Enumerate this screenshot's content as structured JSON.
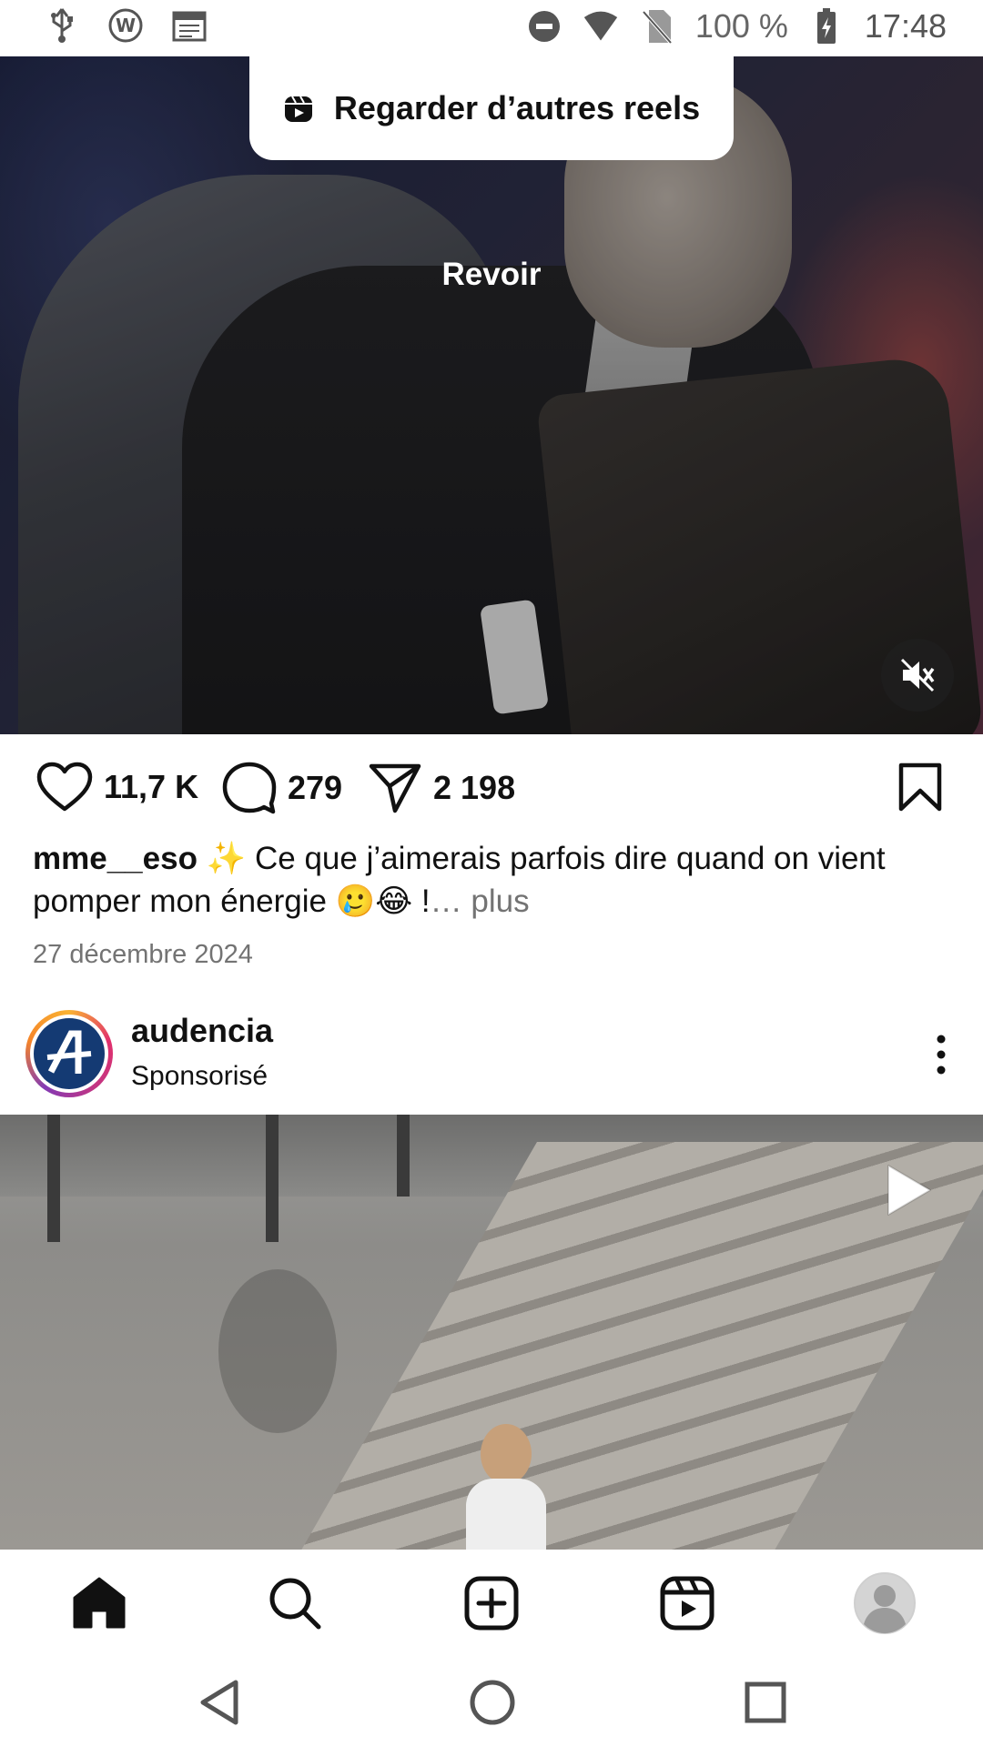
{
  "status_bar": {
    "battery_percent": "100 %",
    "time": "17:48",
    "icons": [
      "usb-icon",
      "wordpress-icon",
      "calendar-icon",
      "do-not-disturb-icon",
      "wifi-icon",
      "no-sim-icon",
      "battery-charging-icon"
    ]
  },
  "reel": {
    "more_reels_label": "Regarder d’autres reels",
    "replay_label": "Revoir",
    "muted": true
  },
  "actions": {
    "likes": "11,7 K",
    "comments": "279",
    "shares": "2 198"
  },
  "caption": {
    "username": "mme__eso",
    "sparkle": "✨",
    "text": " Ce que j’aimerais parfois dire quand on vient pomper mon énergie ",
    "emojis": "🥲😂",
    "tail": " !",
    "more": "… plus"
  },
  "post_date": "27 décembre 2024",
  "sponsored_post": {
    "username": "audencia",
    "label": "Sponsorisé"
  },
  "bottom_nav": [
    "home-icon",
    "search-icon",
    "create-icon",
    "reels-icon",
    "profile-icon"
  ],
  "colors": {
    "secondary_text": "#737373",
    "accent_dark": "#111111"
  }
}
